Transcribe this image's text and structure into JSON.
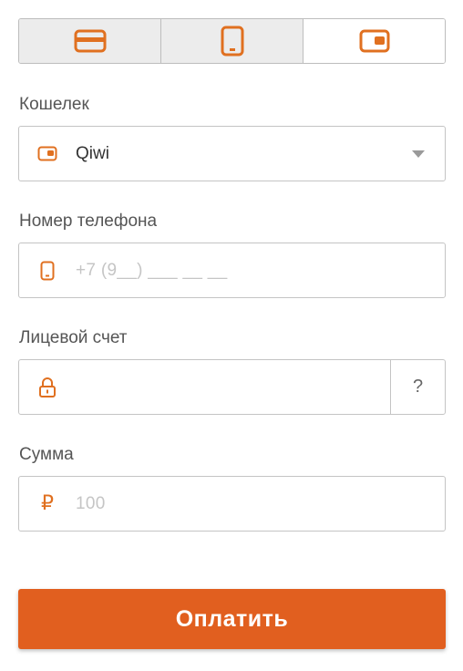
{
  "tabs": [
    {
      "name": "card",
      "icon": "credit-card-icon",
      "active": false
    },
    {
      "name": "mobile",
      "icon": "mobile-phone-icon",
      "active": false
    },
    {
      "name": "wallet",
      "icon": "wallet-icon",
      "active": true
    }
  ],
  "colors": {
    "accent": "#e15f1f",
    "icon": "#e07020",
    "border": "#c4c4c4",
    "tab_inactive_bg": "#ececec"
  },
  "wallet": {
    "label": "Кошелек",
    "value": "Qiwi",
    "icon": "wallet-icon"
  },
  "phone": {
    "label": "Номер телефона",
    "placeholder": "+7 (9__) ___ __ __",
    "icon": "mobile-phone-icon"
  },
  "account": {
    "label": "Лицевой счет",
    "value": "",
    "icon": "lock-icon",
    "help": "?"
  },
  "amount": {
    "label": "Сумма",
    "placeholder": "100",
    "currency_symbol": "₽"
  },
  "pay_button": {
    "label": "Оплатить"
  }
}
